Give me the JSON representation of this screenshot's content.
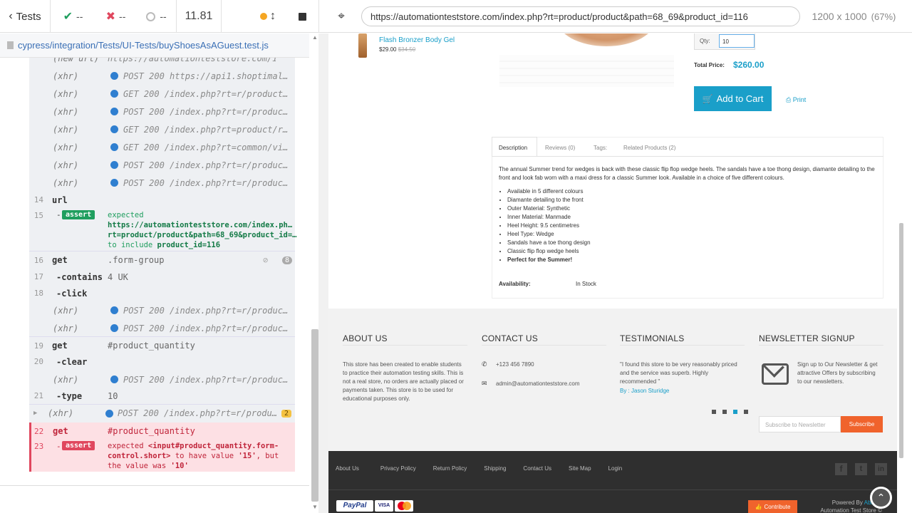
{
  "top": {
    "back_label": "Tests",
    "passed": "--",
    "failed": "--",
    "pending": "--",
    "duration": "11.81",
    "url": "https://automationteststore.com/index.php?rt=product/product&path=68_69&product_id=116",
    "viewport": "1200 x 1000",
    "zoom": "(67%)"
  },
  "spec_path": "cypress/integration/Tests/UI-Tests/buyShoesAsAGuest.test.js",
  "log": {
    "rows": [
      {
        "type": "xhr",
        "label": "(new url)",
        "text": "https://automationteststore.com/in…"
      },
      {
        "type": "xhr",
        "label": "(xhr)",
        "text": "POST 200 https://api1.shoptimal…"
      },
      {
        "type": "xhr",
        "label": "(xhr)",
        "text": "GET 200 /index.php?rt=r/product…"
      },
      {
        "type": "xhr",
        "label": "(xhr)",
        "text": "POST 200 /index.php?rt=r/produc…"
      },
      {
        "type": "xhr",
        "label": "(xhr)",
        "text": "GET 200 /index.php?rt=product/r…"
      },
      {
        "type": "xhr",
        "label": "(xhr)",
        "text": "GET 200 /index.php?rt=common/vi…"
      },
      {
        "type": "xhr",
        "label": "(xhr)",
        "text": "POST 200 /index.php?rt=r/produc…"
      },
      {
        "type": "xhr",
        "label": "(xhr)",
        "text": "POST 200 /index.php?rt=r/produc…"
      }
    ],
    "cmd14": {
      "num": "14",
      "name": "url"
    },
    "cmd15": {
      "num": "15",
      "name": "assert",
      "expected": "expected",
      "url": "https://automationteststore.com/index.ph… rt=product/product&path=68_69&product_id=…",
      "to_include": "to include",
      "product": "product_id=116"
    },
    "cmd16": {
      "num": "16",
      "name": "get",
      "value": ".form-group",
      "count": "8"
    },
    "cmd17": {
      "num": "17",
      "name": "-contains",
      "value": "4 UK"
    },
    "cmd18": {
      "num": "18",
      "name": "-click"
    },
    "xhr_after18": [
      {
        "label": "(xhr)",
        "text": "POST 200 /index.php?rt=r/produc…"
      },
      {
        "label": "(xhr)",
        "text": "POST 200 /index.php?rt=r/produc…"
      }
    ],
    "cmd19": {
      "num": "19",
      "name": "get",
      "value": "#product_quantity"
    },
    "cmd20": {
      "num": "20",
      "name": "-clear"
    },
    "xhr_after20": {
      "label": "(xhr)",
      "text": "POST 200 /index.php?rt=r/produc…"
    },
    "cmd21": {
      "num": "21",
      "name": "-type",
      "value": "10"
    },
    "xhr_after21": {
      "label": "(xhr)",
      "text": "POST 200 /index.php?rt=r/produ…",
      "count": "2"
    },
    "cmd22": {
      "num": "22",
      "name": "get",
      "value": "#product_quantity"
    },
    "cmd23": {
      "num": "23",
      "name": "-assert",
      "expected": "expected",
      "element": "<input#product_quantity.form-control.short>",
      "to_have": "to have value",
      "want": "'15'",
      "but": ", but the value was",
      "got": "'10'"
    }
  },
  "product": {
    "related_name": "Flash Bronzer Body Gel",
    "related_price": "$29.00",
    "related_old_price": "$34.50",
    "qty_label": "Qty:",
    "qty_value": "10",
    "total_label": "Total Price:",
    "total_value": "$260.00",
    "add_to_cart": "Add to Cart",
    "print": "Print",
    "tabs": [
      "Description",
      "Reviews (0)",
      "Tags:",
      "Related Products (2)"
    ],
    "description": "The annual Summer trend for wedges is back with these classic flip flop wedge heels. The sandals have a toe thong design, diamante detailing to the front and look fab worn with a maxi dress for a classic Summer look. Available in a choice of five different colours.",
    "bullets": [
      "Available in 5 different colours",
      "Diamante detailing to the front",
      "Outer Material: Synthetic",
      "Inner Material: Manmade",
      "Heel Height: 9.5 centimetres",
      "Heel Type: Wedge",
      "Sandals have a toe thong design",
      "Classic flip flop wedge heels",
      "Perfect for the Summer!"
    ],
    "availability_label": "Availability:",
    "availability_value": "In Stock"
  },
  "footer": {
    "about_title": "ABOUT US",
    "about_text": "This store has been created to enable students to practice their automation testing skills. This is not a real store, no orders are actually placed or payments taken. This store is to be used for educational purposes only.",
    "contact_title": "CONTACT US",
    "phone": "+123 456 7890",
    "email": "admin@automationteststore.com",
    "testimonials_title": "TESTIMONIALS",
    "testimonial": "\"I found this store to be very reasonably priced and the service was superb. Highly recommended \"",
    "testimonial_by": "By : Jason Sturidge",
    "newsletter_title": "NEWSLETTER SIGNUP",
    "newsletter_text": "Sign up to Our Newsletter & get attractive Offers by subscribing to our newsletters.",
    "subscribe_placeholder": "Subscribe to Newsletter",
    "subscribe_button": "Subscribe",
    "links": [
      "About Us",
      "Privacy Policy",
      "Return Policy",
      "Shipping",
      "Contact Us",
      "Site Map",
      "Login"
    ],
    "contribute": "Contribute",
    "powered_by": "Powered By",
    "abante": "Abante",
    "copyright": "Automation Test Store © 2022",
    "payments": [
      "PayPal",
      "VISA",
      "MasterCard"
    ]
  },
  "colors": {
    "pass_green": "#1f9e5e",
    "fail_red": "#e0475e",
    "accent_blue": "#1a9fc9",
    "orange": "#f0632c"
  }
}
